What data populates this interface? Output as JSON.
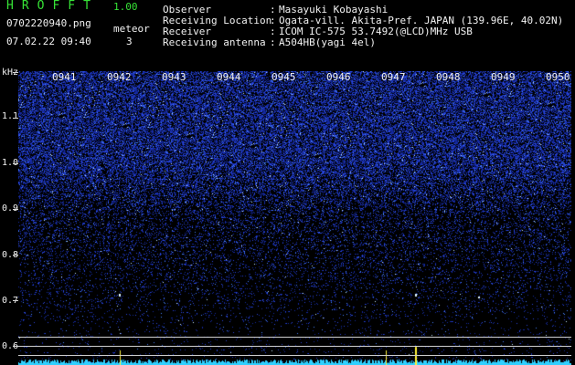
{
  "app": {
    "title": "HROFFT",
    "version": "1.00",
    "file_name": "0702220940.png",
    "timestamp": "07.02.22 09:40",
    "meteor_label": "meteor",
    "meteor_count": "3"
  },
  "info": [
    {
      "label": "Observer",
      "value": "Masayuki Kobayashi"
    },
    {
      "label": "Receiving Location",
      "value": "Ogata-vill. Akita-Pref. JAPAN (139.96E, 40.02N)"
    },
    {
      "label": "Receiver",
      "value": "ICOM IC-575 53.7492(@LCD)MHz USB"
    },
    {
      "label": "Receiving antenna",
      "value": "A504HB(yagi 4el)"
    }
  ],
  "spectrogram": {
    "unit_label": "kHz",
    "y_ticks": [
      "1.1",
      "1.0",
      "0.9",
      "0.8",
      "0.7",
      "0.6"
    ],
    "time_labels": [
      "0941",
      "0942",
      "0943",
      "0944",
      "0945",
      "0946",
      "0947",
      "0948",
      "0949",
      "0950"
    ],
    "colors": {
      "signal": "#3a5cff",
      "bright": "#e0f4ff",
      "trace": "#2fd0ff",
      "highlight": "#fff23a"
    }
  }
}
